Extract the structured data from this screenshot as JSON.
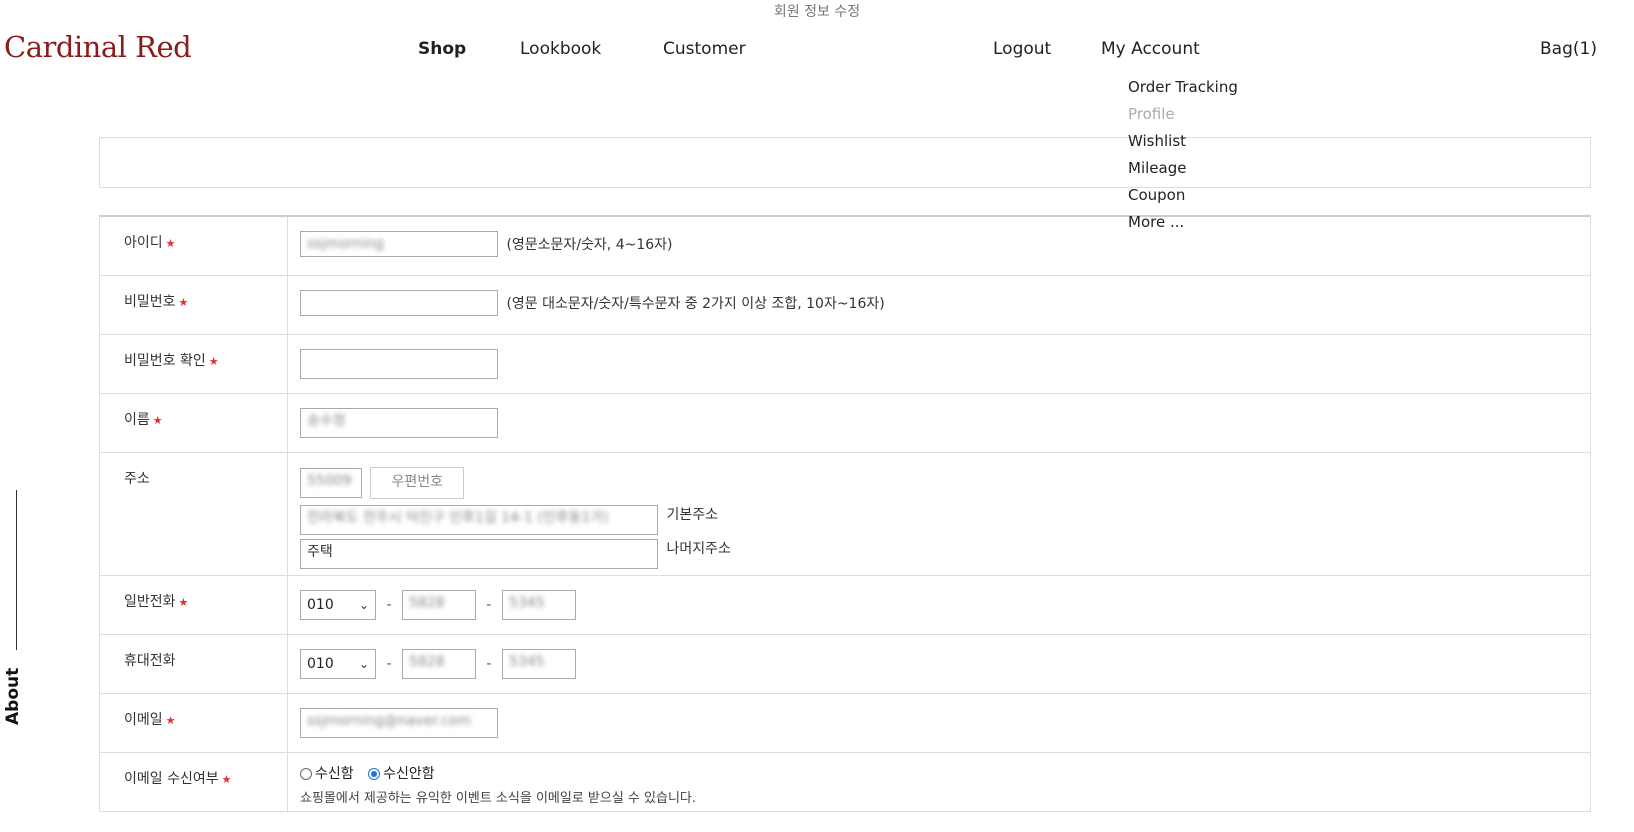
{
  "header": {
    "page_title": "회원 정보 수정",
    "logo": "Cardinal Red",
    "nav": [
      "Shop",
      "Lookbook",
      "Customer"
    ],
    "logout": "Logout",
    "my_account": "My Account",
    "bag": "Bag(1)"
  },
  "account_menu": [
    "Order Tracking",
    "Profile",
    "Wishlist",
    "Mileage",
    "Coupon",
    "More ..."
  ],
  "sidebar": {
    "about": "About"
  },
  "required_mark": "★",
  "form": {
    "id": {
      "label": "아이디",
      "value": "ssjmorning",
      "hint": "(영문소문자/숫자, 4~16자)"
    },
    "password": {
      "label": "비밀번호",
      "value": "",
      "hint": "(영문 대소문자/숫자/특수문자 중 2가지 이상 조합, 10자~16자)"
    },
    "password_confirm": {
      "label": "비밀번호 확인",
      "value": ""
    },
    "name": {
      "label": "이름",
      "value": "송수정"
    },
    "address": {
      "label": "주소",
      "zip_value": "55009",
      "zip_button": "우편번호",
      "base_value": "전라북도 전주시 덕진구 인후1길 14-1 (인후동1가)",
      "base_hint": "기본주소",
      "detail_value": "주택",
      "detail_hint": "나머지주소"
    },
    "phone": {
      "label": "일반전화",
      "prefix": "010",
      "mid": "5828",
      "last": "5345"
    },
    "mobile": {
      "label": "휴대전화",
      "prefix": "010",
      "mid": "5828",
      "last": "5345"
    },
    "email": {
      "label": "이메일",
      "value": "ssjmorning@naver.com"
    },
    "email_opt": {
      "label": "이메일 수신여부",
      "option_yes": "수신함",
      "option_no": "수신안함",
      "selected": "수신안함",
      "note": "쇼핑몰에서 제공하는 유익한 이벤트 소식을 이메일로 받으실 수 있습니다."
    }
  }
}
